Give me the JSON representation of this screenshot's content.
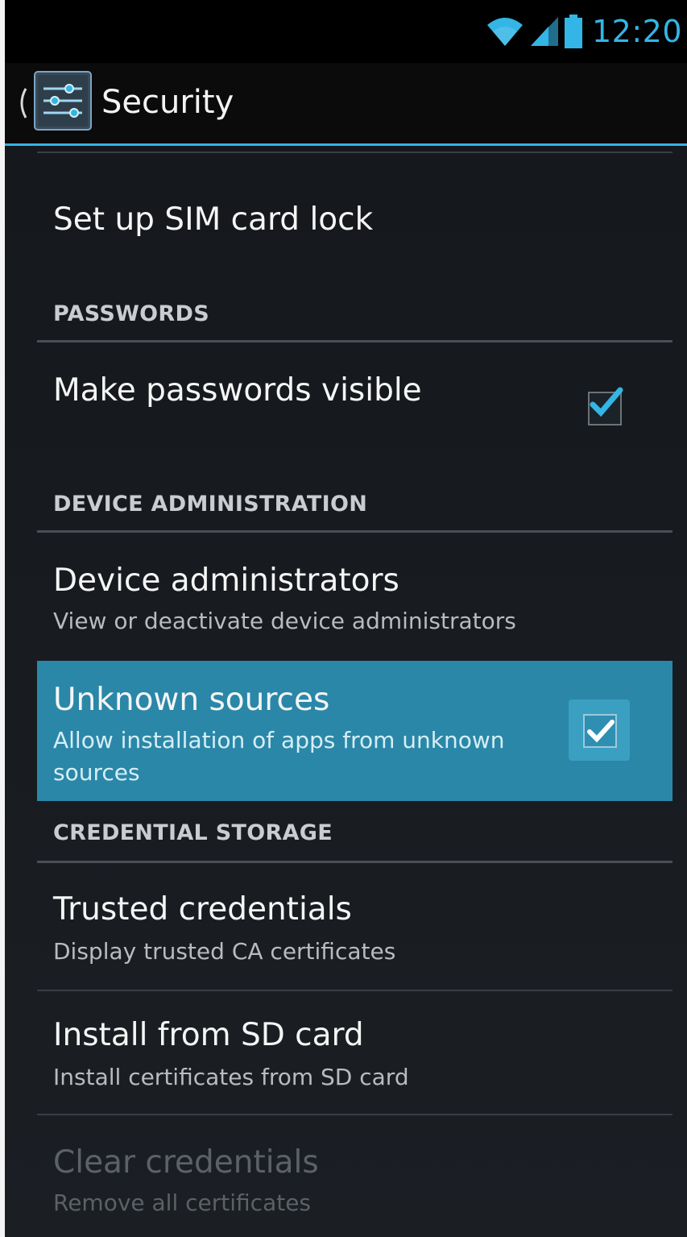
{
  "status_bar": {
    "time": "12:20",
    "icons": [
      "wifi-icon",
      "signal-icon",
      "battery-icon"
    ]
  },
  "action_bar": {
    "title": "Security",
    "icon": "settings-sliders-icon"
  },
  "colors": {
    "accent": "#33b5e5",
    "highlight": "#2a87a8"
  },
  "items": {
    "sim_lock": {
      "title": "Set up SIM card lock"
    },
    "make_passwords_visible": {
      "title": "Make passwords visible",
      "checked": true
    },
    "device_administrators": {
      "title": "Device administrators",
      "summary": "View or deactivate device administrators"
    },
    "unknown_sources": {
      "title": "Unknown sources",
      "summary_line1": "Allow installation of apps from unknown",
      "summary_line2": "sources",
      "checked": true
    },
    "trusted_credentials": {
      "title": "Trusted credentials",
      "summary": "Display trusted CA certificates"
    },
    "install_from_sd": {
      "title": "Install from SD card",
      "summary": "Install certificates from SD card"
    },
    "clear_credentials": {
      "title": "Clear credentials",
      "summary": "Remove all certificates",
      "enabled": false
    }
  },
  "sections": {
    "passwords": "PASSWORDS",
    "device_administration": "DEVICE ADMINISTRATION",
    "credential_storage": "CREDENTIAL STORAGE"
  }
}
